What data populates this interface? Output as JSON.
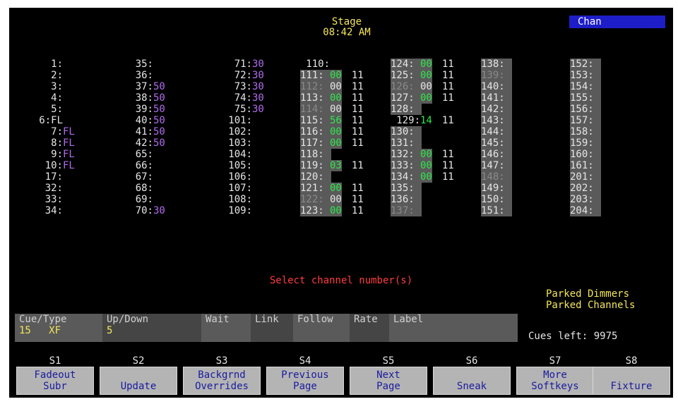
{
  "header": {
    "title": "Stage",
    "time": "08:42 AM",
    "mode_badge": "Chan"
  },
  "columns": [
    {
      "rows": [
        {
          "ch": "1:",
          "lvl": ""
        },
        {
          "ch": "2:",
          "lvl": ""
        },
        {
          "ch": "3:",
          "lvl": ""
        },
        {
          "ch": "4:",
          "lvl": ""
        },
        {
          "ch": "5:",
          "lvl": ""
        },
        {
          "ch": "6:FL",
          "lvl": ""
        },
        {
          "ch": "7:",
          "lvl": "FL"
        },
        {
          "ch": "8:",
          "lvl": "FL"
        },
        {
          "ch": "9:",
          "lvl": "FL"
        },
        {
          "ch": "10:",
          "lvl": "FL"
        },
        {
          "ch": "17:",
          "lvl": ""
        },
        {
          "ch": "32:",
          "lvl": ""
        },
        {
          "ch": "33:",
          "lvl": ""
        },
        {
          "ch": "34:",
          "lvl": ""
        }
      ]
    },
    {
      "rows": [
        {
          "ch": "35:",
          "lvl": ""
        },
        {
          "ch": "36:",
          "lvl": ""
        },
        {
          "ch": "37:",
          "lvl": "50"
        },
        {
          "ch": "38:",
          "lvl": "50"
        },
        {
          "ch": "39:",
          "lvl": "50"
        },
        {
          "ch": "40:",
          "lvl": "50"
        },
        {
          "ch": "41:",
          "lvl": "50"
        },
        {
          "ch": "42:",
          "lvl": "50"
        },
        {
          "ch": "65:",
          "lvl": ""
        },
        {
          "ch": "66:",
          "lvl": ""
        },
        {
          "ch": "67:",
          "lvl": ""
        },
        {
          "ch": "68:",
          "lvl": ""
        },
        {
          "ch": "69:",
          "lvl": ""
        },
        {
          "ch": "70:",
          "lvl": "30"
        }
      ]
    },
    {
      "rows": [
        {
          "ch": "71:",
          "lvl": "30"
        },
        {
          "ch": "72:",
          "lvl": "30"
        },
        {
          "ch": "73:",
          "lvl": "30"
        },
        {
          "ch": "74:",
          "lvl": "30"
        },
        {
          "ch": "75:",
          "lvl": "30"
        },
        {
          "ch": "101:",
          "lvl": ""
        },
        {
          "ch": "102:",
          "lvl": ""
        },
        {
          "ch": "103:",
          "lvl": ""
        },
        {
          "ch": "104:",
          "lvl": ""
        },
        {
          "ch": "105:",
          "lvl": ""
        },
        {
          "ch": "106:",
          "lvl": ""
        },
        {
          "ch": "107:",
          "lvl": ""
        },
        {
          "ch": "108:",
          "lvl": ""
        },
        {
          "ch": "109:",
          "lvl": ""
        }
      ]
    },
    {
      "rows": [
        {
          "ch": "110:",
          "lvl": "",
          "ext": "",
          "park": false,
          "dim": false
        },
        {
          "ch": "111:",
          "lvl": "00",
          "ext": "11",
          "park": true,
          "dim": false
        },
        {
          "ch": "112:",
          "lvl": "00",
          "ext": "11",
          "park": true,
          "dim": true
        },
        {
          "ch": "113:",
          "lvl": "00",
          "ext": "11",
          "park": true,
          "dim": false
        },
        {
          "ch": "114:",
          "lvl": "00",
          "ext": "11",
          "park": true,
          "dim": true
        },
        {
          "ch": "115:",
          "lvl": "56",
          "ext": "11",
          "park": true,
          "dim": false
        },
        {
          "ch": "116:",
          "lvl": "00",
          "ext": "11",
          "park": true,
          "dim": false
        },
        {
          "ch": "117:",
          "lvl": "00",
          "ext": "11",
          "park": true,
          "dim": false
        },
        {
          "ch": "118:",
          "lvl": "",
          "ext": "",
          "park": true,
          "dim": false
        },
        {
          "ch": "119:",
          "lvl": "03",
          "ext": "11",
          "park": true,
          "dim": false
        },
        {
          "ch": "120:",
          "lvl": "",
          "ext": "",
          "park": true,
          "dim": false
        },
        {
          "ch": "121:",
          "lvl": "00",
          "ext": "11",
          "park": true,
          "dim": false
        },
        {
          "ch": "122:",
          "lvl": "00",
          "ext": "11",
          "park": true,
          "dim": true
        },
        {
          "ch": "123:",
          "lvl": "00",
          "ext": "11",
          "park": true,
          "dim": false
        }
      ]
    },
    {
      "rows": [
        {
          "ch": "124:",
          "lvl": "00",
          "ext": "11",
          "park": true,
          "dim": false
        },
        {
          "ch": "125:",
          "lvl": "00",
          "ext": "11",
          "park": true,
          "dim": false
        },
        {
          "ch": "126:",
          "lvl": "00",
          "ext": "11",
          "park": true,
          "dim": true
        },
        {
          "ch": "127:",
          "lvl": "00",
          "ext": "11",
          "park": true,
          "dim": false
        },
        {
          "ch": "128:",
          "lvl": "",
          "ext": "",
          "park": true,
          "dim": false
        },
        {
          "ch": "129:",
          "lvl": "14",
          "ext": "11",
          "park": false,
          "dim": false
        },
        {
          "ch": "130:",
          "lvl": "",
          "ext": "",
          "park": true,
          "dim": false
        },
        {
          "ch": "131:",
          "lvl": "",
          "ext": "",
          "park": true,
          "dim": false
        },
        {
          "ch": "132:",
          "lvl": "00",
          "ext": "11",
          "park": true,
          "dim": false
        },
        {
          "ch": "133:",
          "lvl": "00",
          "ext": "11",
          "park": true,
          "dim": false
        },
        {
          "ch": "134:",
          "lvl": "00",
          "ext": "11",
          "park": true,
          "dim": false
        },
        {
          "ch": "135:",
          "lvl": "",
          "ext": "",
          "park": true,
          "dim": false
        },
        {
          "ch": "136:",
          "lvl": "",
          "ext": "",
          "park": true,
          "dim": false
        },
        {
          "ch": "137:",
          "lvl": "",
          "ext": "",
          "park": true,
          "dim": true
        }
      ]
    },
    {
      "rows": [
        {
          "ch": "138:",
          "park": true,
          "dim": false
        },
        {
          "ch": "139:",
          "park": true,
          "dim": true
        },
        {
          "ch": "140:",
          "park": true,
          "dim": false
        },
        {
          "ch": "141:",
          "park": true,
          "dim": false
        },
        {
          "ch": "142:",
          "park": true,
          "dim": false
        },
        {
          "ch": "143:",
          "park": true,
          "dim": false
        },
        {
          "ch": "144:",
          "park": true,
          "dim": false
        },
        {
          "ch": "145:",
          "park": true,
          "dim": false
        },
        {
          "ch": "146:",
          "park": true,
          "dim": false
        },
        {
          "ch": "147:",
          "park": true,
          "dim": false
        },
        {
          "ch": "148:",
          "park": true,
          "dim": true
        },
        {
          "ch": "149:",
          "park": true,
          "dim": false
        },
        {
          "ch": "150:",
          "park": true,
          "dim": false
        },
        {
          "ch": "151:",
          "park": true,
          "dim": false
        }
      ]
    },
    {
      "rows": [
        {
          "ch": "152:",
          "park": true,
          "dim": false
        },
        {
          "ch": "153:",
          "park": true,
          "dim": false
        },
        {
          "ch": "154:",
          "park": true,
          "dim": false
        },
        {
          "ch": "155:",
          "park": true,
          "dim": false
        },
        {
          "ch": "156:",
          "park": true,
          "dim": false
        },
        {
          "ch": "157:",
          "park": true,
          "dim": false
        },
        {
          "ch": "158:",
          "park": true,
          "dim": false
        },
        {
          "ch": "159:",
          "park": true,
          "dim": false
        },
        {
          "ch": "160:",
          "park": true,
          "dim": false
        },
        {
          "ch": "161:",
          "park": true,
          "dim": false
        },
        {
          "ch": "201:",
          "park": true,
          "dim": false
        },
        {
          "ch": "202:",
          "park": true,
          "dim": false
        },
        {
          "ch": "203:",
          "park": true,
          "dim": false
        },
        {
          "ch": "204:",
          "park": true,
          "dim": false
        }
      ]
    }
  ],
  "prompt": "Select channel number(s)",
  "legend": {
    "parked_dimmers": "Parked Dimmers",
    "parked_channels": "Parked Channels"
  },
  "cue": {
    "headers": [
      "Cue/Type",
      "Up/Down",
      "Wait",
      "Link",
      "Follow",
      "Rate",
      "Label"
    ],
    "cue_number": "15",
    "cue_type": "XF",
    "up_down": "5",
    "cues_left": "Cues left: 9975"
  },
  "softkeys": [
    {
      "key": "S1",
      "label": "Fadeout\nSubr"
    },
    {
      "key": "S2",
      "label": "\nUpdate"
    },
    {
      "key": "S3",
      "label": "Backgrnd\nOverrides"
    },
    {
      "key": "S4",
      "label": "Previous\nPage"
    },
    {
      "key": "S5",
      "label": "Next\nPage"
    },
    {
      "key": "S6",
      "label": "\nSneak"
    },
    {
      "key": "S7",
      "label": "More\nSoftkeys"
    },
    {
      "key": "S8",
      "label": "\nFixture"
    }
  ],
  "colors": {
    "background": "#000000",
    "title": "#f5e65a",
    "level_purple": "#b06cf0",
    "level_green": "#2ee84a",
    "prompt_red": "#ff3c3c",
    "mode_badge": "#1e1ec8",
    "parked_bg": "#5a5a5a",
    "softkey_bg": "#b4b4b4",
    "softkey_text": "#1a1aa0"
  }
}
